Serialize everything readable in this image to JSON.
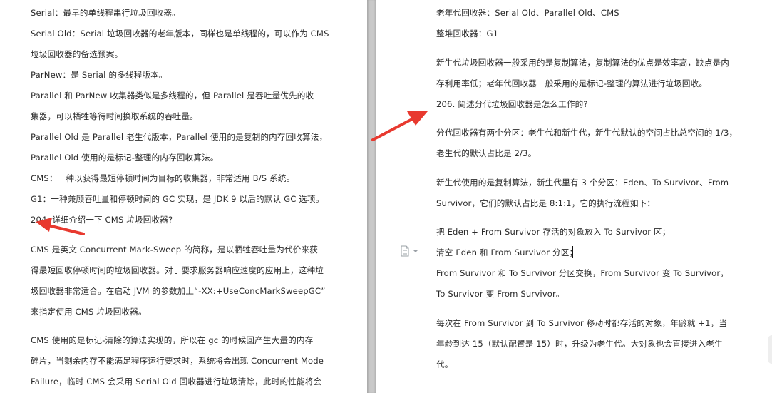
{
  "left_page": {
    "lines": [
      "Serial：最早的单线程串行垃圾回收器。",
      "Serial Old：Serial  垃圾回收器的老年版本，同样也是单线程的，可以作为  CMS",
      "垃圾回收器的备选预案。",
      "ParNew：是  Serial  的多线程版本。",
      "Parallel  和  ParNew  收集器类似是多线程的，但  Parallel  是吞吐量优先的收",
      "集器，可以牺牲等待时间换取系统的吞吐量。",
      "Parallel Old  是  Parallel  老生代版本，Parallel  使用的是复制的内存回收算法，",
      "Parallel  Old  使用的是标记-整理的内存回收算法。",
      "CMS：一种以获得最短停顿时间为目标的收集器，非常适用  B/S  系统。",
      "G1：一种兼顾吞吐量和停顿时间的  GC  实现，是  JDK 9  以后的默认  GC  选项。",
      "204. 详细介绍一下  CMS  垃圾回收器?",
      "CMS  是英文  Concurrent  Mark-Sweep  的简称，是以牺牲吞吐量为代价来获",
      "得最短回收停顿时间的垃圾回收器。对于要求服务器响应速度的应用上，这种垃",
      "圾回收器非常适合。在启动  JVM  的参数加上“-XX:+UseConcMarkSweepGC”",
      "来指定使用  CMS  垃圾回收器。",
      "CMS  使用的是标记-清除的算法实现的，所以在  gc  的时候回产生大量的内存",
      "碎片，当剩余内存不能满足程序运行要求时，系统将会出现  Concurrent Mode",
      "Failure，临时  CMS  会采用  Serial Old  回收器进行垃圾清除，此时的性能将会"
    ]
  },
  "right_page": {
    "lines": [
      "老年代回收器：Serial Old、Parallel Old、CMS",
      "整堆回收器：G1",
      "新生代垃圾回收器一般采用的是复制算法，复制算法的优点是效率高，缺点是内",
      "存利用率低；老年代回收器一般采用的是标记-整理的算法进行垃圾回收。",
      "206. 简述分代垃圾回收器是怎么工作的?",
      "分代回收器有两个分区：老生代和新生代，新生代默认的空间占比总空间的  1/3，",
      "老生代的默认占比是  2/3。",
      "新生代使用的是复制算法，新生代里有  3  个分区：Eden、To Survivor、From",
      "Survivor，它们的默认占比是  8:1:1，它的执行流程如下：",
      "把  Eden + From Survivor  存活的对象放入  To Survivor  区；",
      "清空  Eden  和  From Survivor  分区；",
      "From Survivor  和  To Survivor  分区交换，From Survivor  变  To Survivor，",
      "To Survivor  变  From Survivor。",
      "每次在  From Survivor  到  To Survivor  移动时都存活的对象，年龄就  +1，当",
      "年龄到达  15（默认配置是  15）时，升级为老生代。大对象也会直接进入老生",
      "代。"
    ]
  },
  "colors": {
    "annotation_arrow": "#e8392f",
    "text": "#2b2b2b",
    "gutter": "#c9c9c9"
  },
  "icons": [
    "document-icon",
    "dropdown-arrow-icon"
  ]
}
